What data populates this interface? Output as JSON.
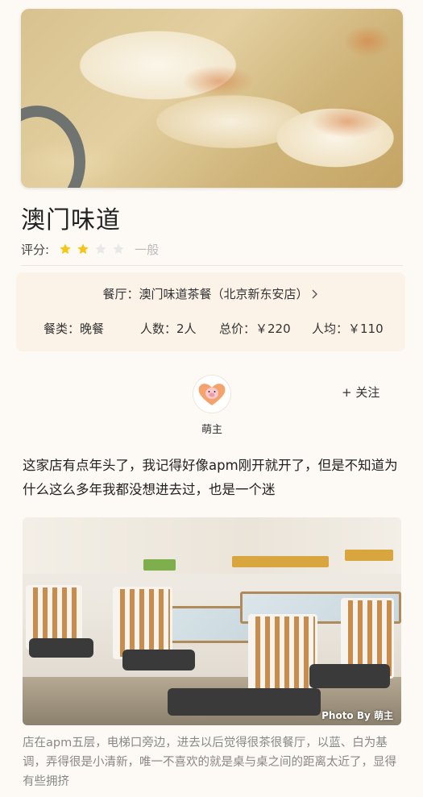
{
  "post": {
    "title": "澳门味道",
    "rating_label": "评分:",
    "rating_stars": 2,
    "rating_max": 5,
    "rating_text": "一般"
  },
  "info": {
    "restaurant": "餐厅：澳门味道茶餐（北京新东安店）",
    "meal_type": "餐类：晚餐",
    "people": "人数：2人",
    "total": "总价：￥220",
    "per_person": "人均：￥110"
  },
  "author": {
    "name": "萌主",
    "follow_label": "+ 关注"
  },
  "content": {
    "paragraph1": "这家店有点年头了，我记得好像apm刚开就开了，但是不知道为什么这么多年我都没想进去过，也是一个迷",
    "photo_credit": "Photo By 萌主",
    "caption": "店在apm五层，电梯口旁边，进去以后觉得很茶很餐厅，以蓝、白为基调，弄得很是小清新，唯一不喜欢的就是桌与桌之间的距离太近了，显得有些拥挤"
  },
  "colors": {
    "star_filled": "#f5c518",
    "star_empty": "#e8e8e8",
    "background": "#fdfaf6",
    "info_card": "#fbf2e8"
  },
  "icons": {
    "chevron": "chevron-right-icon",
    "avatar": "pig-heart-avatar"
  }
}
